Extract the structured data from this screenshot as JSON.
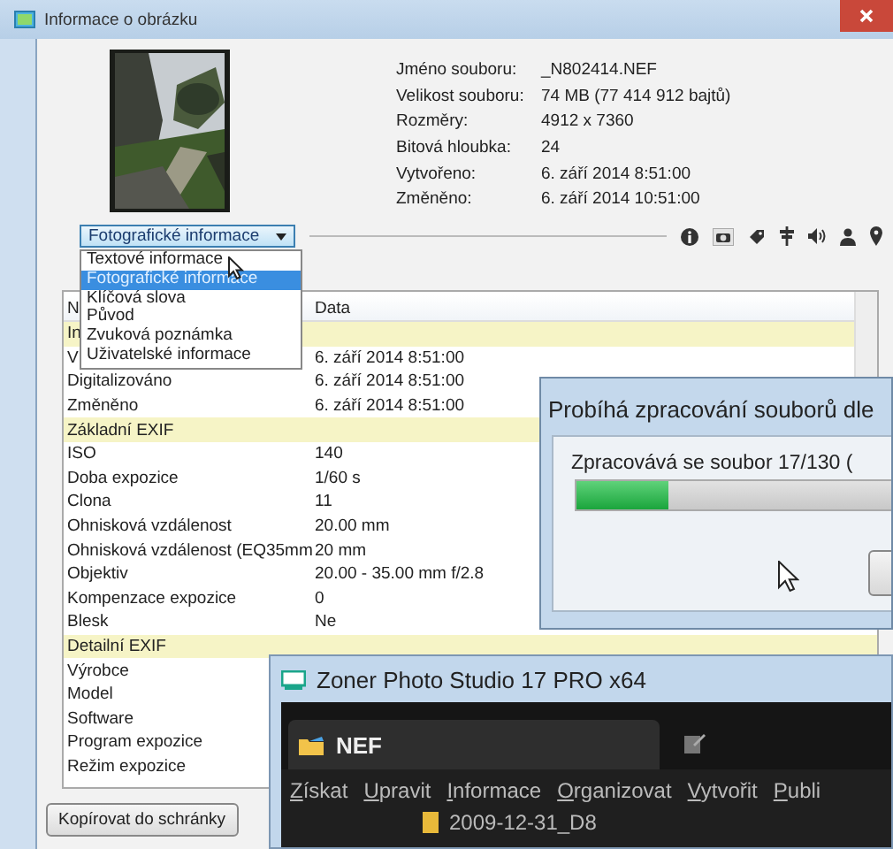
{
  "dialog": {
    "title": "Informace o obrázku",
    "file_info": [
      {
        "label": "Jméno souboru:",
        "value": "_N802414.NEF"
      },
      {
        "label": "Velikost souboru:",
        "value": "74 MB (77 414 912 bajtů)"
      },
      {
        "label": "Rozměry:",
        "value": "4912 x 7360"
      },
      {
        "label": "Bitová hloubka:",
        "value": "24"
      },
      {
        "label": "Vytvořeno:",
        "value": "6. září 2014 8:51:00"
      },
      {
        "label": "Změněno:",
        "value": "6. září 2014 10:51:00"
      }
    ],
    "view_select": {
      "value": "Fotografické informace",
      "expanded": true,
      "options": [
        {
          "label": "Textové informace",
          "selected": false
        },
        {
          "label": "Fotografické informace",
          "selected": true
        },
        {
          "label": "Klíčová slova",
          "selected": false
        },
        {
          "label": "Původ",
          "selected": false
        },
        {
          "label": "Zvuková poznámka",
          "selected": false
        },
        {
          "label": "Uživatelské informace",
          "selected": false
        }
      ]
    },
    "table": {
      "columns": [
        "N",
        "Data"
      ],
      "rows": [
        {
          "kind": "group",
          "name": "In"
        },
        {
          "kind": "item",
          "name": "V",
          "value": "6. září 2014 8:51:00"
        },
        {
          "kind": "item",
          "name": "Digitalizováno",
          "value": "6. září 2014 8:51:00"
        },
        {
          "kind": "item",
          "name": "Změněno",
          "value": "6. září 2014 8:51:00"
        },
        {
          "kind": "group",
          "name": "Základní EXIF"
        },
        {
          "kind": "item",
          "name": "ISO",
          "value": "140"
        },
        {
          "kind": "item",
          "name": "Doba expozice",
          "value": "1/60 s"
        },
        {
          "kind": "item",
          "name": "Clona",
          "value": "11"
        },
        {
          "kind": "item",
          "name": "Ohnisková vzdálenost",
          "value": "20.00 mm"
        },
        {
          "kind": "item",
          "name": "Ohnisková vzdálenost (EQ35mm",
          "value": "20 mm"
        },
        {
          "kind": "item",
          "name": "Objektiv",
          "value": "20.00 - 35.00 mm f/2.8"
        },
        {
          "kind": "item",
          "name": "Kompenzace expozice",
          "value": "0"
        },
        {
          "kind": "item",
          "name": "Blesk",
          "value": "Ne"
        },
        {
          "kind": "group",
          "name": "Detailní EXIF"
        },
        {
          "kind": "item",
          "name": "Výrobce"
        },
        {
          "kind": "item",
          "name": "Model"
        },
        {
          "kind": "item",
          "name": "Software"
        },
        {
          "kind": "item",
          "name": "Program expozice"
        },
        {
          "kind": "item",
          "name": "Režim expozice"
        }
      ]
    },
    "copy_button": "Kopírovat do schránky"
  },
  "progress_dialog": {
    "title": "Probíhá zpracování souborů dle",
    "message": "Zpracovává se soubor 17/130 (",
    "level": 0.2
  },
  "app_window": {
    "title": "Zoner Photo Studio 17 PRO x64",
    "tab": "NEF",
    "menu": [
      "Získat",
      "Upravit",
      "Informace",
      "Organizovat",
      "Vytvořit",
      "Publi"
    ],
    "path": "2009-12-31_D8"
  }
}
